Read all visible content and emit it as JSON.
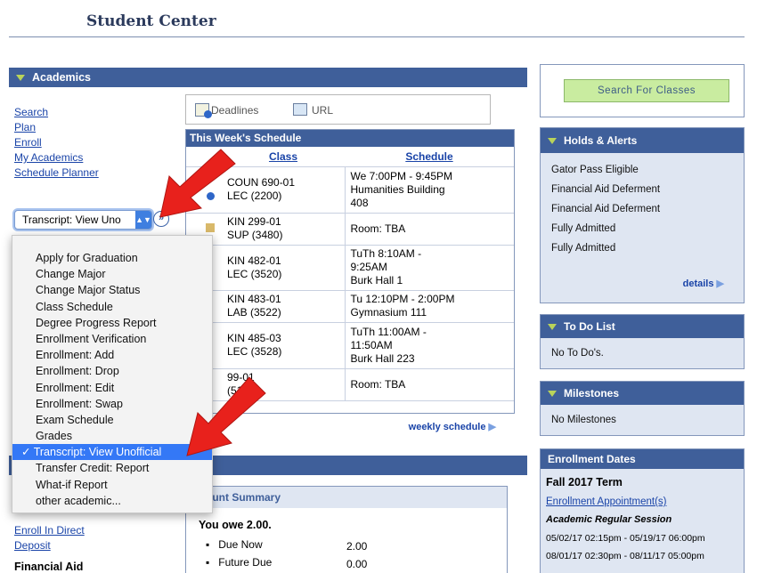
{
  "header": {
    "title": "Student Center"
  },
  "academics": {
    "title": "Academics",
    "links": [
      "Search",
      "Plan",
      "Enroll",
      "My Academics",
      "Schedule Planner"
    ],
    "select_value": "Transcript: View Uno"
  },
  "dropdown": {
    "items": [
      "Apply for Graduation",
      "Change Major",
      "Change Major Status",
      "Class Schedule",
      "Degree Progress Report",
      "Enrollment Verification",
      "Enrollment: Add",
      "Enrollment: Drop",
      "Enrollment: Edit",
      "Enrollment: Swap",
      "Exam Schedule",
      "Grades",
      "Transcript: View Unofficial",
      "Transfer Credit: Report",
      "What-if Report",
      "other academic..."
    ],
    "selected": "✓ Transcript: View Unofficial"
  },
  "toolbar": {
    "deadlines": "Deadlines",
    "url": "URL"
  },
  "schedule": {
    "title": "This Week's Schedule",
    "col_class": "Class",
    "col_schedule": "Schedule",
    "rows": [
      {
        "cls1": "COUN 690-01",
        "cls2": "LEC (2200)",
        "s1": "We 7:00PM - 9:45PM",
        "s2": "Humanities Building",
        "s3": "408"
      },
      {
        "cls1": "KIN 299-01",
        "cls2": "SUP (3480)",
        "s1": "Room:  TBA",
        "s2": "",
        "s3": ""
      },
      {
        "cls1": "KIN 482-01",
        "cls2": "LEC (3520)",
        "s1": "TuTh 8:10AM -",
        "s2": "9:25AM",
        "s3": "Burk Hall 1"
      },
      {
        "cls1": "KIN 483-01",
        "cls2": "LAB (3522)",
        "s1": "Tu 12:10PM - 2:00PM",
        "s2": "Gymnasium 111",
        "s3": ""
      },
      {
        "cls1": "KIN 485-03",
        "cls2": "LEC (3528)",
        "s1": "TuTh 11:00AM -",
        "s2": "11:50AM",
        "s3": "Burk Hall 223"
      },
      {
        "cls1": "99-01",
        "cls2": "(5170)",
        "s1": "Room:  TBA",
        "s2": "",
        "s3": ""
      }
    ],
    "weekly_link": "weekly schedule"
  },
  "search_button": "Search For Classes",
  "holds": {
    "title": "Holds & Alerts",
    "items": [
      "Gator Pass Eligible",
      "Financial Aid Deferment",
      "Financial Aid Deferment",
      "Fully Admitted",
      "Fully Admitted"
    ],
    "details": "details"
  },
  "todo": {
    "title": "To Do List",
    "text": "No To Do's."
  },
  "milestones": {
    "title": "Milestones",
    "text": "No Milestones"
  },
  "enrollment": {
    "title": "Enrollment Dates",
    "term": "Fall 2017 Term",
    "link": "Enrollment Appointment(s)",
    "session": "Academic Regular Session",
    "dates": [
      "05/02/17 02:15pm - 05/19/17 06:00pm",
      "08/01/17 02:30pm - 08/11/17 05:00pm"
    ]
  },
  "finances": {
    "links": [
      "Enroll In Direct",
      "Deposit"
    ],
    "aid_label": "Financial Aid",
    "account_title": "ount Summary",
    "owe": "You owe 2.00.",
    "due_now_label": "Due Now",
    "due_now": "2.00",
    "future_label": "Future Due",
    "future": "0.00"
  },
  "colors": {
    "header_blue": "#3f5f9a",
    "panel_bg": "#dfe6f2",
    "arrow_red": "#e8211c",
    "menu_highlight": "#3478f6"
  }
}
